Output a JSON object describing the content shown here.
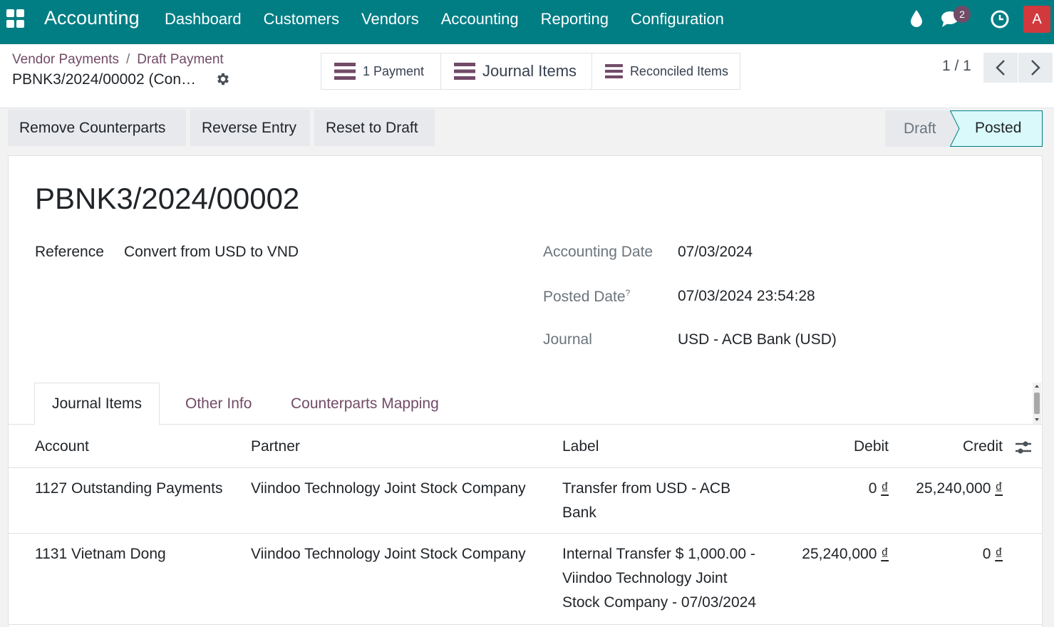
{
  "topbar": {
    "brand": "Accounting",
    "menu": [
      "Dashboard",
      "Customers",
      "Vendors",
      "Accounting",
      "Reporting",
      "Configuration"
    ],
    "notification_count": "2",
    "avatar_letter": "A",
    "color": "#017e84"
  },
  "breadcrumb": {
    "items": [
      "Vendor Payments",
      "Draft Payment"
    ],
    "record": "PBNK3/2024/00002 (Con…"
  },
  "smart_buttons": {
    "payment": "1 Payment",
    "journal_items": "Journal Items",
    "reconciled_items": "Reconciled Items"
  },
  "pager": {
    "value": "1 / 1"
  },
  "actions": {
    "remove_counterparts": "Remove Counterparts",
    "reverse_entry": "Reverse Entry",
    "reset_to_draft": "Reset to Draft"
  },
  "status": {
    "draft": "Draft",
    "posted": "Posted",
    "current": "Posted"
  },
  "form": {
    "title": "PBNK3/2024/00002",
    "reference_label": "Reference",
    "reference_value": "Convert from USD to VND",
    "accounting_date_label": "Accounting Date",
    "accounting_date_value": "07/03/2024",
    "posted_date_label": "Posted Date",
    "posted_date_help": "?",
    "posted_date_value": "07/03/2024 23:54:28",
    "journal_label": "Journal",
    "journal_value": "USD - ACB Bank (USD)"
  },
  "tabs": [
    "Journal Items",
    "Other Info",
    "Counterparts Mapping"
  ],
  "table": {
    "headers": {
      "account": "Account",
      "partner": "Partner",
      "label": "Label",
      "debit": "Debit",
      "credit": "Credit"
    },
    "rows": [
      {
        "account": "1127 Outstanding Payments",
        "partner": "Viindoo Technology Joint Stock Company",
        "label_lines": [
          "Transfer from USD - ACB",
          "Bank"
        ],
        "debit": "0",
        "credit": "25,240,000",
        "currency": "₫"
      },
      {
        "account": "1131 Vietnam Dong",
        "partner": "Viindoo Technology Joint Stock Company",
        "label_lines": [
          "Internal Transfer $ 1,000.00 -",
          "Viindoo Technology Joint",
          "Stock Company - 07/03/2024"
        ],
        "debit": "25,240,000",
        "credit": "0",
        "currency": "₫"
      }
    ]
  }
}
